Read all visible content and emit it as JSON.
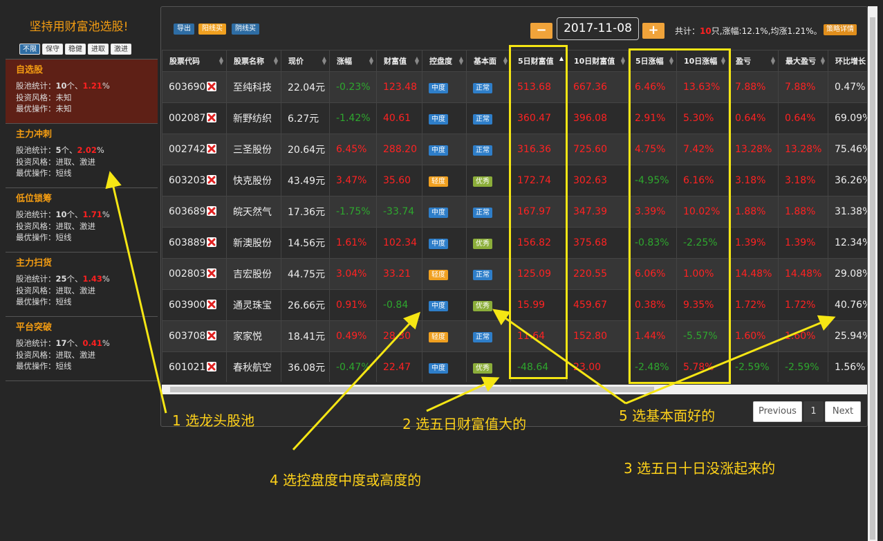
{
  "sidebar": {
    "title": "坚持用财富池选股!",
    "styles": [
      "不限",
      "保守",
      "稳健",
      "进取",
      "激进"
    ],
    "stat_label": "股池统计：",
    "style_label": "投资风格：",
    "op_label": "最优操作：",
    "pools": [
      {
        "name": "自选股",
        "count": "10",
        "count_unit": "个、",
        "pct": "1.21",
        "pct_unit": "%",
        "style": "未知",
        "op": "未知",
        "active": true
      },
      {
        "name": "主力冲刺",
        "count": "5",
        "count_unit": "个、",
        "pct": "2.02",
        "pct_unit": "%",
        "style": "进取、激进",
        "op": "短线",
        "active": false
      },
      {
        "name": "低位锁筹",
        "count": "10",
        "count_unit": "个、",
        "pct": "1.71",
        "pct_unit": "%",
        "style": "进取、激进",
        "op": "短线",
        "active": false
      },
      {
        "name": "主力扫货",
        "count": "25",
        "count_unit": "个、",
        "pct": "1.43",
        "pct_unit": "%",
        "style": "进取、激进",
        "op": "短线",
        "active": false
      },
      {
        "name": "平台突破",
        "count": "17",
        "count_unit": "个、",
        "pct": "0.41",
        "pct_unit": "%",
        "style": "进取、激进",
        "op": "短线",
        "active": false
      }
    ]
  },
  "toolbar": {
    "export": "导出",
    "buy_yang": "阳线买",
    "buy_yin": "阴线买",
    "minus": "−",
    "plus": "+",
    "date": "2017-11-08",
    "summary_prefix": "共计：",
    "summary_count": "10",
    "summary_rest": "只,涨幅:12.1%,均涨1.21%。",
    "detail": "策略详情"
  },
  "table": {
    "headers": [
      "股票代码",
      "股票名称",
      "现价",
      "涨幅",
      "财富值",
      "控盘度",
      "基本面",
      "5日财富值",
      "10日财富值",
      "5日涨幅",
      "10日涨幅",
      "盈亏",
      "最大盈亏",
      "环比增长"
    ],
    "rows": [
      {
        "code": "603690",
        "name": "至纯科技",
        "price": "22.04元",
        "chg": "-0.23%",
        "wealth": "123.48",
        "control": "中度",
        "fund": "正常",
        "w5": "513.68",
        "w10": "667.36",
        "c5": "6.46%",
        "c10": "13.63%",
        "pl": "7.88%",
        "maxpl": "7.88%",
        "mom": "0.47%"
      },
      {
        "code": "002087",
        "name": "新野纺织",
        "price": "6.27元",
        "chg": "-1.42%",
        "wealth": "40.61",
        "control": "中度",
        "fund": "正常",
        "w5": "360.47",
        "w10": "396.08",
        "c5": "2.91%",
        "c10": "5.30%",
        "pl": "0.64%",
        "maxpl": "0.64%",
        "mom": "69.09%"
      },
      {
        "code": "002742",
        "name": "三圣股份",
        "price": "20.64元",
        "chg": "6.45%",
        "wealth": "288.20",
        "control": "中度",
        "fund": "正常",
        "w5": "316.36",
        "w10": "725.60",
        "c5": "4.75%",
        "c10": "7.42%",
        "pl": "13.28%",
        "maxpl": "13.28%",
        "mom": "75.46%"
      },
      {
        "code": "603203",
        "name": "快克股份",
        "price": "43.49元",
        "chg": "3.47%",
        "wealth": "35.60",
        "control": "轻度",
        "fund": "优秀",
        "w5": "172.74",
        "w10": "302.63",
        "c5": "-4.95%",
        "c10": "6.16%",
        "pl": "3.18%",
        "maxpl": "3.18%",
        "mom": "36.26%"
      },
      {
        "code": "603689",
        "name": "皖天然气",
        "price": "17.36元",
        "chg": "-1.75%",
        "wealth": "-33.74",
        "control": "中度",
        "fund": "正常",
        "w5": "167.97",
        "w10": "347.39",
        "c5": "3.39%",
        "c10": "10.02%",
        "pl": "1.88%",
        "maxpl": "1.88%",
        "mom": "31.38%"
      },
      {
        "code": "603889",
        "name": "新澳股份",
        "price": "14.56元",
        "chg": "1.61%",
        "wealth": "102.34",
        "control": "中度",
        "fund": "优秀",
        "w5": "156.82",
        "w10": "375.68",
        "c5": "-0.83%",
        "c10": "-2.25%",
        "pl": "1.39%",
        "maxpl": "1.39%",
        "mom": "12.34%"
      },
      {
        "code": "002803",
        "name": "吉宏股份",
        "price": "44.75元",
        "chg": "3.04%",
        "wealth": "33.21",
        "control": "轻度",
        "fund": "正常",
        "w5": "125.09",
        "w10": "220.55",
        "c5": "6.06%",
        "c10": "1.00%",
        "pl": "14.48%",
        "maxpl": "14.48%",
        "mom": "29.08%"
      },
      {
        "code": "603900",
        "name": "通灵珠宝",
        "price": "26.66元",
        "chg": "0.91%",
        "wealth": "-0.84",
        "control": "中度",
        "fund": "优秀",
        "w5": "15.99",
        "w10": "459.67",
        "c5": "0.38%",
        "c10": "9.35%",
        "pl": "1.72%",
        "maxpl": "1.72%",
        "mom": "40.76%"
      },
      {
        "code": "603708",
        "name": "家家悦",
        "price": "18.41元",
        "chg": "0.49%",
        "wealth": "28.30",
        "control": "轻度",
        "fund": "正常",
        "w5": "11.64",
        "w10": "152.80",
        "c5": "1.44%",
        "c10": "-5.57%",
        "pl": "1.60%",
        "maxpl": "1.60%",
        "mom": "25.94%"
      },
      {
        "code": "601021",
        "name": "春秋航空",
        "price": "36.08元",
        "chg": "-0.47%",
        "wealth": "22.47",
        "control": "中度",
        "fund": "优秀",
        "w5": "-48.64",
        "w10": "23.00",
        "c5": "-2.48%",
        "c10": "5.78%",
        "pl": "-2.59%",
        "maxpl": "-2.59%",
        "mom": "1.56%"
      }
    ]
  },
  "pagination": {
    "prev": "Previous",
    "page": "1",
    "next": "Next"
  },
  "annotations": [
    "1 选龙头股池",
    "2 选五日财富值大的",
    "3 选五日十日没涨起来的",
    "4 选控盘度中度或高度的",
    "5 选基本面好的"
  ],
  "colors": {
    "accent": "#f39c12",
    "up": "#ff2222",
    "down": "#2ea82e",
    "highlight": "#f5e614",
    "note": "#ffd21a"
  }
}
